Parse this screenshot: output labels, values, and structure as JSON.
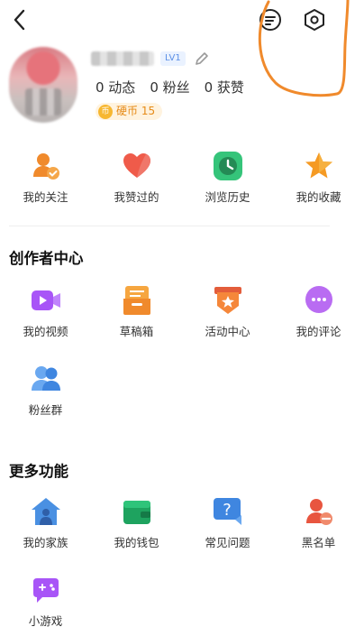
{
  "header": {
    "back_icon": "back-arrow-icon",
    "menu_icon": "list-lines-icon",
    "settings_icon": "hexagon-gear-icon"
  },
  "profile": {
    "level": "LV1",
    "stats": {
      "posts": "0 动态",
      "fans": "0 粉丝",
      "likes": "0 获赞"
    },
    "coins": {
      "icon_text": "币",
      "label": "硬币 15"
    }
  },
  "quick": [
    {
      "label": "我的关注",
      "icon": "follow-user-icon"
    },
    {
      "label": "我赞过的",
      "icon": "heart-icon"
    },
    {
      "label": "浏览历史",
      "icon": "clock-icon"
    },
    {
      "label": "我的收藏",
      "icon": "star-icon"
    }
  ],
  "creator": {
    "title": "创作者中心",
    "items": [
      {
        "label": "我的视频",
        "icon": "video-camera-icon"
      },
      {
        "label": "草稿箱",
        "icon": "draft-box-icon"
      },
      {
        "label": "活动中心",
        "icon": "activity-banner-icon"
      },
      {
        "label": "我的评论",
        "icon": "comment-bubble-icon"
      },
      {
        "label": "粉丝群",
        "icon": "fans-group-icon"
      }
    ]
  },
  "more": {
    "title": "更多功能",
    "items": [
      {
        "label": "我的家族",
        "icon": "family-house-icon"
      },
      {
        "label": "我的钱包",
        "icon": "wallet-icon"
      },
      {
        "label": "常见问题",
        "icon": "faq-question-icon"
      },
      {
        "label": "黑名单",
        "icon": "blacklist-user-icon"
      },
      {
        "label": "小游戏",
        "icon": "game-controller-icon"
      }
    ]
  },
  "colors": {
    "accent_orange": "#f08a2c",
    "blue": "#4a90e2",
    "green": "#2fb66d",
    "purple": "#8b5cf6"
  }
}
